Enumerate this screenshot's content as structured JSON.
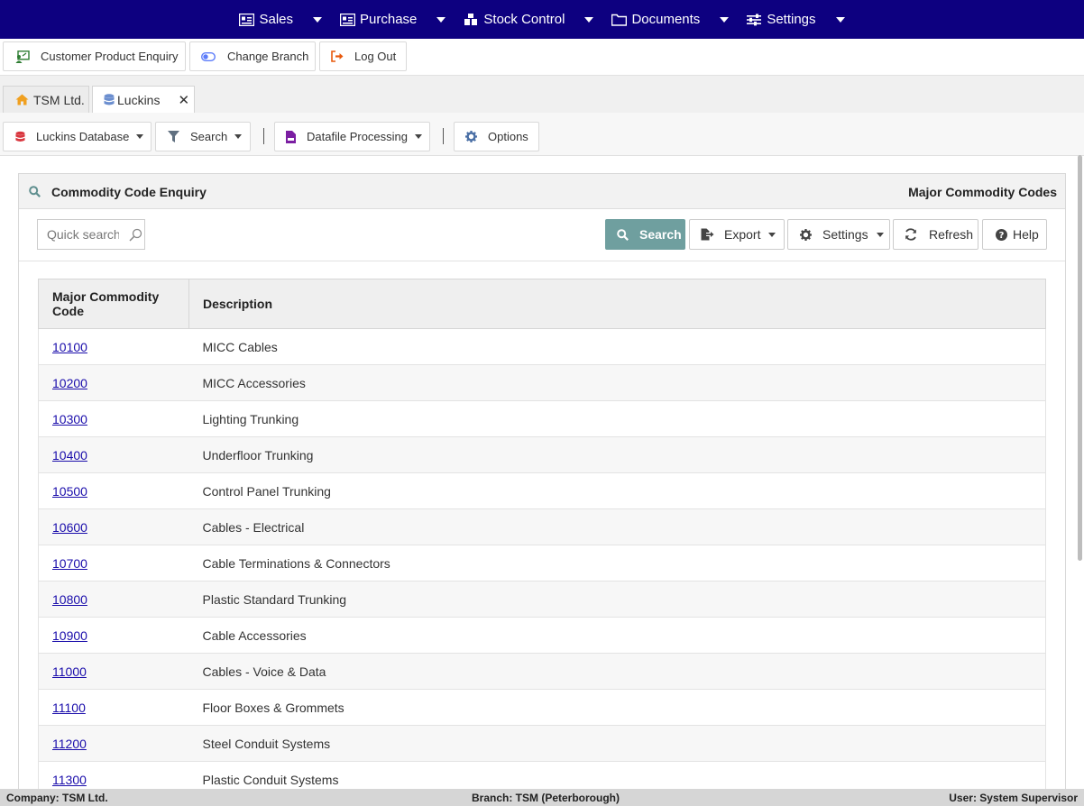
{
  "top_nav": [
    {
      "label": "Sales",
      "icon": "id-card-icon"
    },
    {
      "label": "Purchase",
      "icon": "id-card-icon"
    },
    {
      "label": "Stock Control",
      "icon": "boxes-icon"
    },
    {
      "label": "Documents",
      "icon": "folder-icon"
    },
    {
      "label": "Settings",
      "icon": "sliders-icon"
    }
  ],
  "toolbar": {
    "customer_enquiry": "Customer Product Enquiry",
    "change_branch": "Change Branch",
    "log_out": "Log Out"
  },
  "tabs": [
    {
      "label": "TSM Ltd.",
      "icon": "home-icon"
    },
    {
      "label": "Luckins",
      "icon": "database-icon",
      "active": true
    }
  ],
  "module_toolbar": {
    "database": "Luckins Database",
    "search": "Search",
    "datafile": "Datafile Processing",
    "options": "Options"
  },
  "panel": {
    "title": "Commodity Code Enquiry",
    "right_title": "Major Commodity Codes",
    "quick_search_placeholder": "Quick search",
    "search_btn": "Search",
    "export_btn": "Export",
    "settings_btn": "Settings",
    "refresh_btn": "Refresh",
    "help_btn": "Help"
  },
  "table": {
    "col1": "Major Commodity Code",
    "col2": "Description",
    "rows": [
      {
        "code": "10100",
        "desc": "MICC Cables"
      },
      {
        "code": "10200",
        "desc": "MICC Accessories"
      },
      {
        "code": "10300",
        "desc": "Lighting Trunking"
      },
      {
        "code": "10400",
        "desc": "Underfloor Trunking"
      },
      {
        "code": "10500",
        "desc": "Control Panel Trunking"
      },
      {
        "code": "10600",
        "desc": "Cables - Electrical"
      },
      {
        "code": "10700",
        "desc": "Cable Terminations & Connectors"
      },
      {
        "code": "10800",
        "desc": "Plastic Standard Trunking"
      },
      {
        "code": "10900",
        "desc": "Cable Accessories"
      },
      {
        "code": "11000",
        "desc": "Cables - Voice & Data"
      },
      {
        "code": "11100",
        "desc": "Floor Boxes & Grommets"
      },
      {
        "code": "11200",
        "desc": "Steel Conduit Systems"
      },
      {
        "code": "11300",
        "desc": "Plastic Conduit Systems"
      }
    ]
  },
  "status": {
    "company": "Company: TSM Ltd.",
    "branch": "Branch: TSM (Peterborough)",
    "user": "User: System Supervisor"
  },
  "colors": {
    "nav_bg": "#0d0080",
    "primary_btn": "#6f9f9f",
    "link": "#1a0dab"
  }
}
